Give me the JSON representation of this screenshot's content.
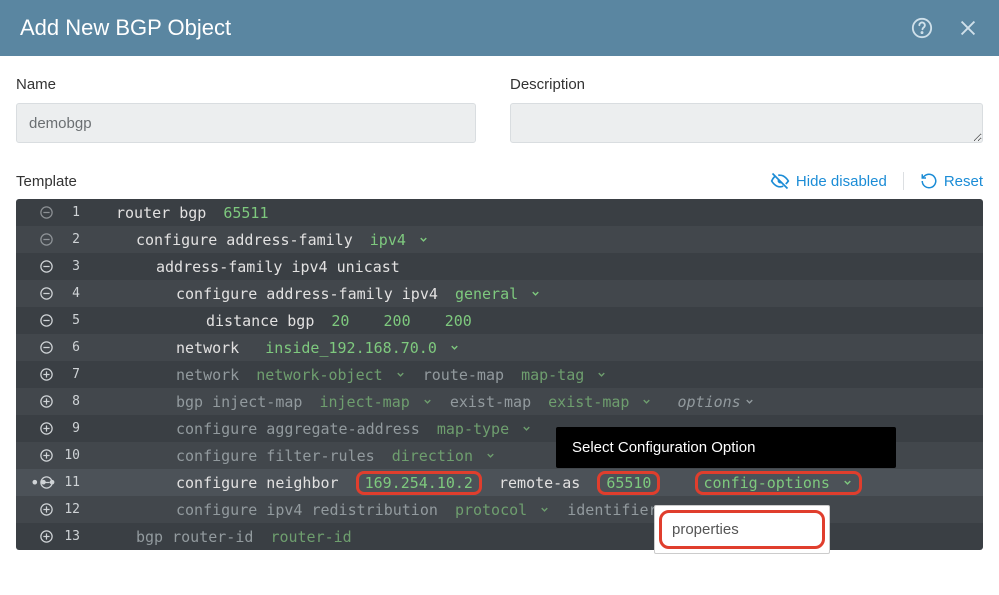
{
  "header": {
    "title": "Add New BGP Object"
  },
  "form": {
    "name_label": "Name",
    "name_value": "demobgp",
    "description_label": "Description",
    "description_value": ""
  },
  "template": {
    "label": "Template",
    "hide_disabled": "Hide disabled",
    "reset": "Reset"
  },
  "popover": {
    "title": "Select Configuration Option",
    "item1": "properties"
  },
  "lines": [
    {
      "n": 1,
      "icon": "collapse-dim",
      "indent": 0,
      "segments": [
        [
          "kw",
          "router bgp "
        ],
        [
          "val",
          "65511"
        ]
      ]
    },
    {
      "n": 2,
      "icon": "collapse-dim",
      "indent": 1,
      "segments": [
        [
          "kw",
          "configure address-family "
        ],
        [
          "dd-val",
          "ipv4"
        ]
      ]
    },
    {
      "n": 3,
      "icon": "collapse",
      "indent": 2,
      "segments": [
        [
          "kw",
          "address-family ipv4 unicast"
        ]
      ]
    },
    {
      "n": 4,
      "icon": "collapse",
      "indent": 3,
      "segments": [
        [
          "kw",
          "configure address-family ipv4 "
        ],
        [
          "dd-val",
          "general"
        ]
      ]
    },
    {
      "n": 5,
      "icon": "collapse",
      "indent": 4,
      "segments": [
        [
          "kw",
          "distance bgp "
        ],
        [
          "val",
          "20"
        ],
        [
          "kw",
          "  "
        ],
        [
          "val",
          "200"
        ],
        [
          "kw",
          "  "
        ],
        [
          "val",
          "200"
        ]
      ]
    },
    {
      "n": 6,
      "icon": "collapse",
      "indent": 3,
      "segments": [
        [
          "kw",
          "network  "
        ],
        [
          "dd-val",
          "inside_192.168.70.0"
        ]
      ]
    },
    {
      "n": 7,
      "icon": "add",
      "indent": 3,
      "segments": [
        [
          "dim",
          "network "
        ],
        [
          "dd-param",
          "network-object"
        ],
        [
          "dim",
          " route-map "
        ],
        [
          "dd-param",
          "map-tag"
        ]
      ]
    },
    {
      "n": 8,
      "icon": "add",
      "indent": 3,
      "segments": [
        [
          "dim",
          "bgp inject-map "
        ],
        [
          "dd-param",
          "inject-map"
        ],
        [
          "dim",
          " exist-map "
        ],
        [
          "dd-param",
          "exist-map"
        ],
        [
          "dim",
          " "
        ],
        [
          "dd-dim",
          "options"
        ]
      ]
    },
    {
      "n": 9,
      "icon": "add",
      "indent": 3,
      "segments": [
        [
          "dim",
          "configure aggregate-address "
        ],
        [
          "dd-param",
          "map-type"
        ]
      ]
    },
    {
      "n": 10,
      "icon": "add",
      "indent": 3,
      "segments": [
        [
          "dim",
          "configure filter-rules "
        ],
        [
          "dd-param",
          "direction"
        ]
      ]
    },
    {
      "n": 11,
      "icon": "collapse",
      "indent": 3,
      "more": true,
      "highlight": true,
      "segments": [
        [
          "kw",
          "configure neighbor "
        ],
        [
          "hl-val",
          "169.254.10.2"
        ],
        [
          "kw",
          " remote-as "
        ],
        [
          "hl-val",
          "65510"
        ],
        [
          "kw",
          "  "
        ],
        [
          "hl-dd-val",
          "config-options"
        ]
      ]
    },
    {
      "n": 12,
      "icon": "add",
      "indent": 3,
      "segments": [
        [
          "dim",
          "configure ipv4 redistribution "
        ],
        [
          "dd-param",
          "protocol"
        ],
        [
          "dim",
          " identifier"
        ]
      ]
    },
    {
      "n": 13,
      "icon": "add",
      "indent": 1,
      "segments": [
        [
          "dim",
          "bgp router-id "
        ],
        [
          "param",
          "router-id"
        ]
      ]
    }
  ]
}
